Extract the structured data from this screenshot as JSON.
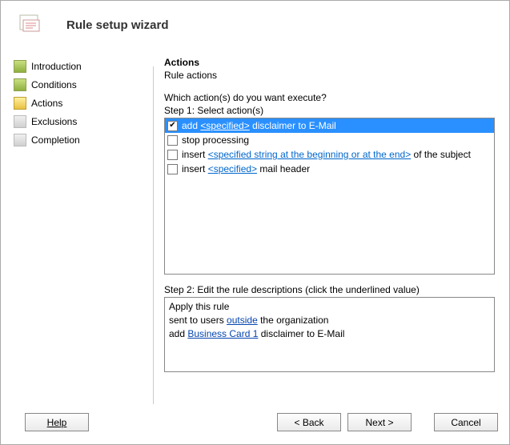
{
  "header": {
    "title": "Rule setup wizard"
  },
  "nav": {
    "items": [
      {
        "label": "Introduction",
        "color": "green"
      },
      {
        "label": "Conditions",
        "color": "green"
      },
      {
        "label": "Actions",
        "color": "yellow"
      },
      {
        "label": "Exclusions",
        "color": "gray"
      },
      {
        "label": "Completion",
        "color": "gray"
      }
    ]
  },
  "main": {
    "section_title": "Actions",
    "section_sub": "Rule actions",
    "question": "Which action(s) do you want execute?",
    "step1_label": "Step 1: Select action(s)",
    "actions": [
      {
        "checked": true,
        "selected": true,
        "pre": "add ",
        "link": "<specified>",
        "post": " disclaimer to E-Mail"
      },
      {
        "checked": false,
        "selected": false,
        "pre": "stop processing",
        "link": "",
        "post": ""
      },
      {
        "checked": false,
        "selected": false,
        "pre": "insert ",
        "link": "<specified string at the beginning or at the end>",
        "post": " of the subject"
      },
      {
        "checked": false,
        "selected": false,
        "pre": "insert ",
        "link": "<specified>",
        "post": " mail header"
      }
    ],
    "step2_label": "Step 2: Edit the rule descriptions (click the underlined value)",
    "desc": {
      "line1": "Apply this rule",
      "line2_pre": "sent to users ",
      "line2_link": "outside",
      "line2_post": " the organization",
      "line3_pre": "add ",
      "line3_link": "Business Card 1",
      "line3_post": " disclaimer to E-Mail"
    }
  },
  "footer": {
    "help": "Help",
    "back": "< Back",
    "next": "Next >",
    "cancel": "Cancel"
  }
}
